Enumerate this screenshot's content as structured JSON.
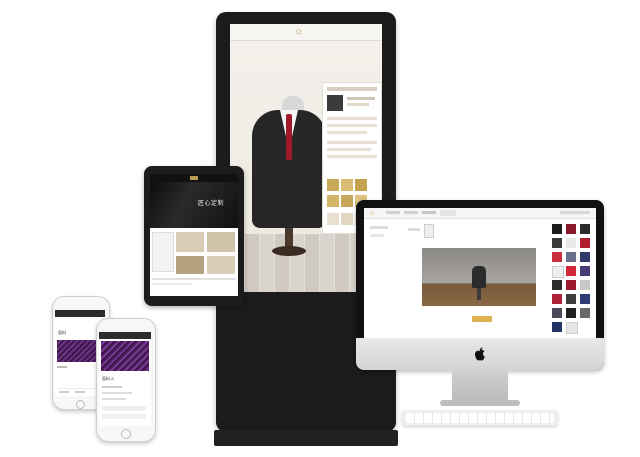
{
  "kiosk": {
    "brand_glyph": "☼",
    "panel_rows": [
      "",
      "",
      "",
      "",
      "",
      ""
    ]
  },
  "tablet": {
    "banner_text": "匠心定制"
  },
  "desktop": {
    "logo_glyph": "☼",
    "nav_tabs": [
      "",
      "",
      "",
      ""
    ],
    "confirm_label": "",
    "accent": "#e0b24f"
  },
  "phone_left": {
    "title": "面料",
    "footer_items": [
      "",
      "",
      ""
    ]
  },
  "phone_right": {
    "label_a": "面料 A",
    "label_b": ""
  },
  "colors": {
    "device_dark": "#1b1b1b",
    "gold": "#b79a55",
    "suit": "#2a2a2a",
    "tie": "#a0182a",
    "fabric_purple": "#5a2a6e"
  }
}
